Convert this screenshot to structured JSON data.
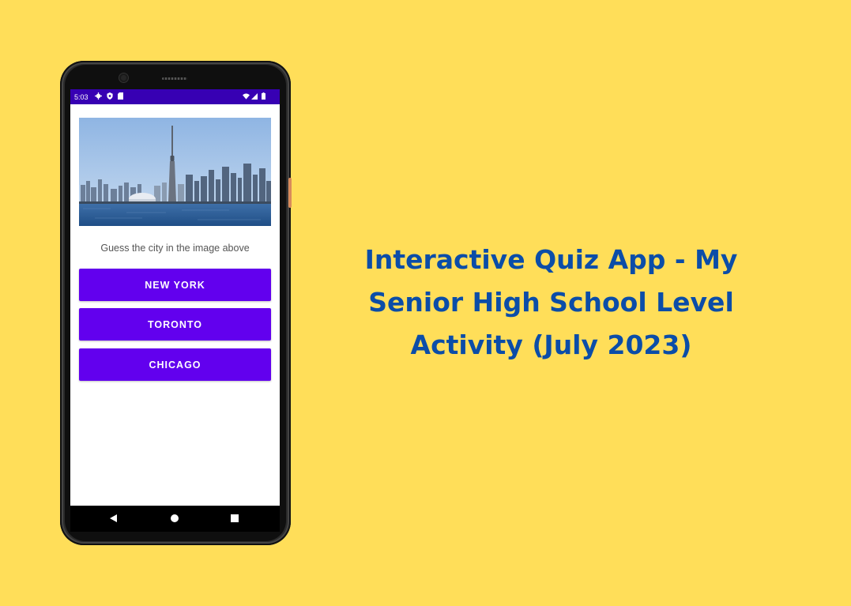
{
  "colors": {
    "background": "#FFDE59",
    "status_bar": "#3700B3",
    "button": "#6200EE",
    "headline": "#0B4DA8"
  },
  "status_bar": {
    "time": "5:03",
    "left_icons": [
      "gear-icon",
      "shield-icon",
      "sd-card-icon"
    ],
    "right_icons": [
      "wifi-icon",
      "signal-icon",
      "battery-icon"
    ]
  },
  "quiz": {
    "image_description": "Toronto skyline with CN Tower",
    "question": "Guess the city in the image above",
    "options": [
      "NEW YORK",
      "TORONTO",
      "CHICAGO"
    ]
  },
  "nav": {
    "icons": [
      "back-icon",
      "home-icon",
      "recents-icon"
    ]
  },
  "headline": {
    "line1": "Interactive Quiz App - My",
    "line2": "Senior High School Level",
    "line3": "Activity (July 2023)"
  }
}
